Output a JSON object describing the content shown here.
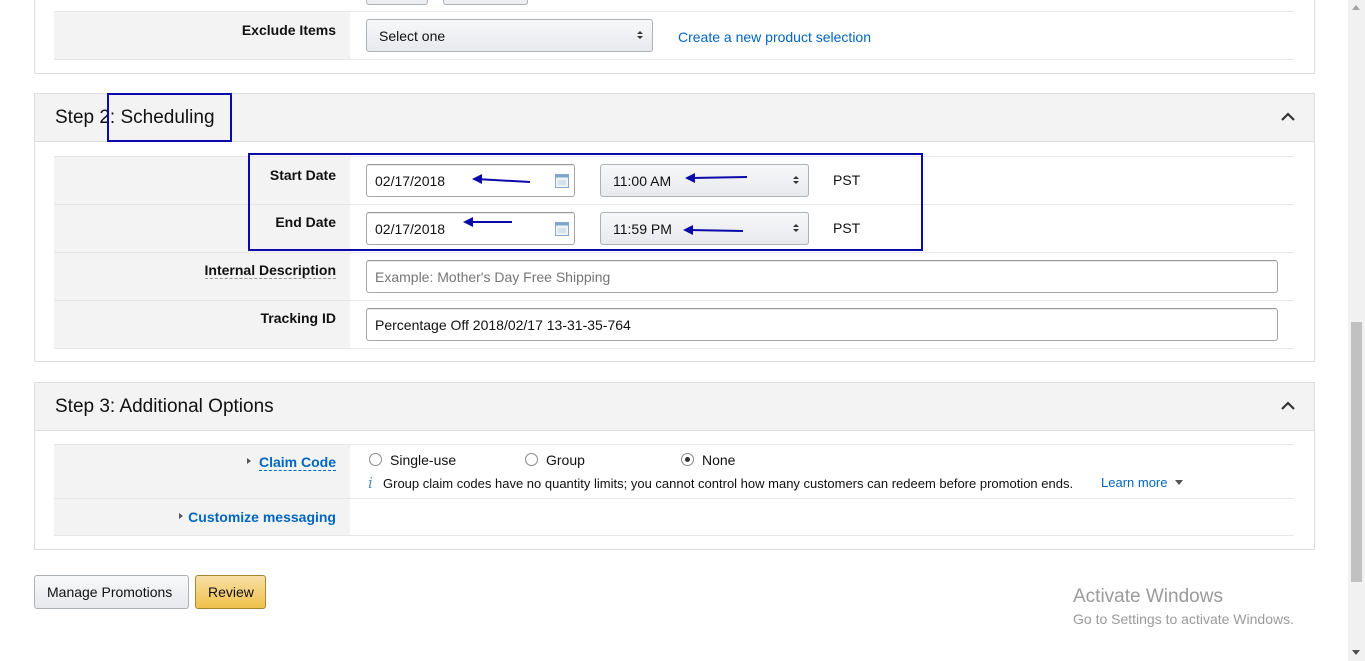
{
  "step1": {
    "exclude_label": "Exclude Items",
    "exclude_select": "Select one",
    "create_link": "Create a new product selection"
  },
  "step2": {
    "title": "Step 2: Scheduling",
    "start_label": "Start Date",
    "start_date": "02/17/2018",
    "start_time": "11:00 AM",
    "end_label": "End Date",
    "end_date": "02/17/2018",
    "end_time": "11:59 PM",
    "timezone": "PST",
    "desc_label": "Internal Description",
    "desc_placeholder": "Example: Mother's Day Free Shipping",
    "tracking_label": "Tracking ID",
    "tracking_value": "Percentage Off 2018/02/17 13-31-35-764"
  },
  "step3": {
    "title": "Step 3: Additional Options",
    "claim_label": "Claim Code",
    "options": [
      "Single-use",
      "Group",
      "None"
    ],
    "selected": "None",
    "info_text": "Group claim codes have no quantity limits; you cannot control how many customers can redeem before promotion ends.",
    "learn_more": "Learn more",
    "customize_label": "Customize messaging"
  },
  "buttons": {
    "manage": "Manage Promotions",
    "review": "Review"
  },
  "watermark": {
    "title": "Activate Windows",
    "subtitle": "Go to Settings to activate Windows."
  },
  "colors": {
    "link": "#0066c0",
    "annotation": "#0a0aaa",
    "review_button": "#f0c14b"
  }
}
